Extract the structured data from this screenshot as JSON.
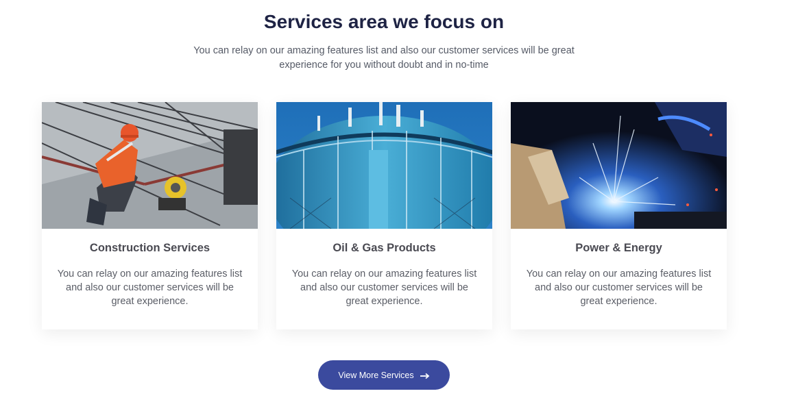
{
  "header": {
    "title": "Services area we focus on",
    "subtitle_line1": "You can relay on our amazing features list and also our customer services will be great",
    "subtitle_line2": "experience for you without doubt and in no-time"
  },
  "services": [
    {
      "title": "Construction Services",
      "text": "You can relay on our amazing features list and also our customer services will be great experience.",
      "image": "construction-worker-photo"
    },
    {
      "title": "Oil & Gas Products",
      "text": "You can relay on our amazing features list and also our customer services will be great experience.",
      "image": "gas-storage-tank-photo"
    },
    {
      "title": "Power & Energy",
      "text": "You can relay on our amazing features list and also our customer services will be great experience.",
      "image": "welding-sparks-photo"
    }
  ],
  "cta": {
    "label": "View More Services",
    "icon": "long-arrow-right-icon",
    "color": "#3b4a9e"
  },
  "colors": {
    "title": "#1e2344",
    "text": "#555a66"
  }
}
